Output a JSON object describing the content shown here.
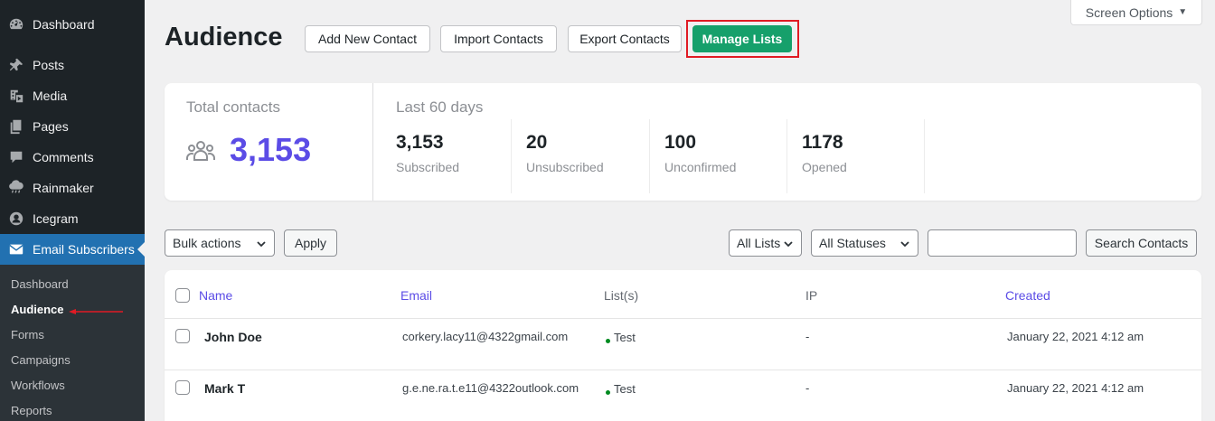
{
  "sidebar": {
    "items": [
      {
        "label": "Dashboard",
        "icon": "dashboard-icon"
      },
      {
        "label": "Posts",
        "icon": "pin-icon"
      },
      {
        "label": "Media",
        "icon": "media-icon"
      },
      {
        "label": "Pages",
        "icon": "pages-icon"
      },
      {
        "label": "Comments",
        "icon": "comment-icon"
      },
      {
        "label": "Rainmaker",
        "icon": "cloud-rain-icon"
      },
      {
        "label": "Icegram",
        "icon": "icegram-icon"
      },
      {
        "label": "Email Subscribers",
        "icon": "envelope-icon",
        "active": true
      }
    ],
    "submenu": [
      "Dashboard",
      "Audience",
      "Forms",
      "Campaigns",
      "Workflows",
      "Reports"
    ],
    "current_submenu": "Audience"
  },
  "header": {
    "title": "Audience",
    "buttons": {
      "add_new_contact": "Add New Contact",
      "import_contacts": "Import Contacts",
      "export_contacts": "Export Contacts",
      "manage_lists": "Manage Lists"
    },
    "screen_options": "Screen Options"
  },
  "stats": {
    "total_label": "Total contacts",
    "total_value": "3,153",
    "period_label": "Last 60 days",
    "items": [
      {
        "value": "3,153",
        "label": "Subscribed"
      },
      {
        "value": "20",
        "label": "Unsubscribed"
      },
      {
        "value": "100",
        "label": "Unconfirmed"
      },
      {
        "value": "1178",
        "label": "Opened"
      }
    ]
  },
  "filters": {
    "bulk_actions": "Bulk actions",
    "apply": "Apply",
    "all_lists": "All Lists",
    "all_statuses": "All Statuses",
    "search_value": "",
    "search_button": "Search Contacts"
  },
  "table": {
    "columns": {
      "name": "Name",
      "email": "Email",
      "lists": "List(s)",
      "ip": "IP",
      "created": "Created"
    },
    "rows": [
      {
        "name": "John Doe",
        "email": "corkery.lacy11@4322gmail.com",
        "list": "Test",
        "ip": "-",
        "created": "January 22, 2021 4:12 am"
      },
      {
        "name": "Mark T",
        "email": "g.e.ne.ra.t.e11@4322outlook.com",
        "list": "Test",
        "ip": "-",
        "created": "January 22, 2021 4:12 am"
      }
    ]
  },
  "colors": {
    "sidebar_bg": "#1d2327",
    "active_menu": "#2271b1",
    "accent_purple": "#5b4ce6",
    "manage_lists_green": "#16a06b",
    "highlight_red": "#e01b24",
    "list_dot_green": "#008a20"
  }
}
